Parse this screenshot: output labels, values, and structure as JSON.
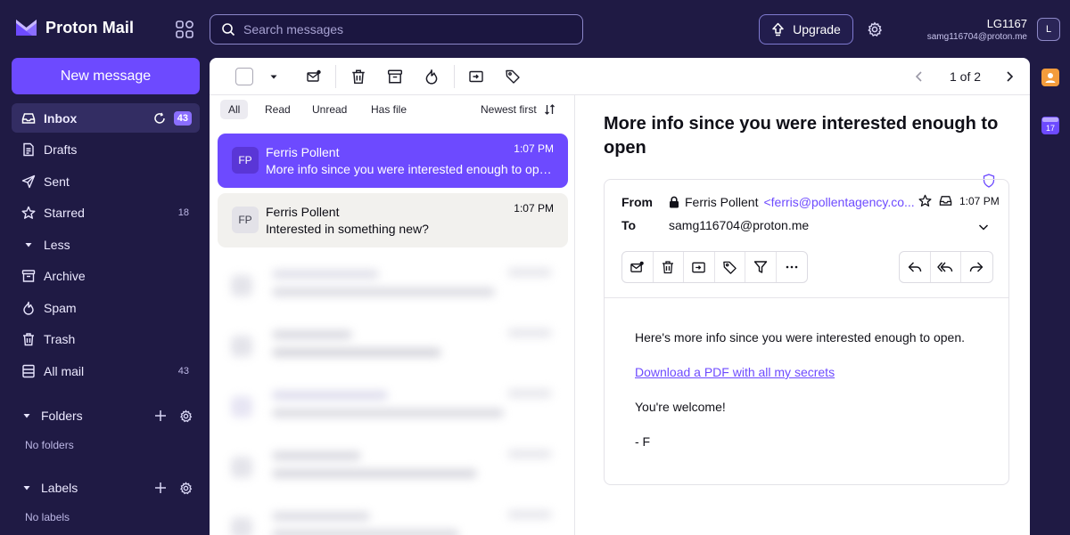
{
  "brand": {
    "name": "Proton Mail",
    "accent": "#6d4aff",
    "background": "#1f1a44"
  },
  "search": {
    "placeholder": "Search messages"
  },
  "header": {
    "upgrade_label": "Upgrade",
    "user_name": "LG1167",
    "user_email": "samg116704@proton.me",
    "avatar_initial": "L"
  },
  "sidebar": {
    "new_message": "New message",
    "items": [
      {
        "label": "Inbox",
        "icon": "inbox-icon",
        "badge": "43",
        "active": true
      },
      {
        "label": "Drafts",
        "icon": "drafts-icon",
        "count": ""
      },
      {
        "label": "Sent",
        "icon": "sent-icon",
        "count": ""
      },
      {
        "label": "Starred",
        "icon": "star-icon",
        "count": "18"
      },
      {
        "label": "Less",
        "icon": "caret-icon",
        "count": ""
      },
      {
        "label": "Archive",
        "icon": "archive-icon",
        "count": ""
      },
      {
        "label": "Spam",
        "icon": "spam-icon",
        "count": ""
      },
      {
        "label": "Trash",
        "icon": "trash-icon",
        "count": ""
      },
      {
        "label": "All mail",
        "icon": "all-mail-icon",
        "count": "43"
      }
    ],
    "folders": {
      "label": "Folders",
      "empty": "No folders"
    },
    "labels": {
      "label": "Labels",
      "empty": "No labels"
    }
  },
  "toolbar": {
    "pager": "1 of 2"
  },
  "list": {
    "filters": [
      "All",
      "Read",
      "Unread",
      "Has file"
    ],
    "active_filter": "All",
    "sort": "Newest first",
    "messages": [
      {
        "initials": "FP",
        "sender": "Ferris Pollent",
        "subject": "More info since you were interested enough to open",
        "time": "1:07 PM",
        "selected": true
      },
      {
        "initials": "FP",
        "sender": "Ferris Pollent",
        "subject": "Interested in something new?",
        "time": "1:07 PM",
        "selected": false
      }
    ]
  },
  "reader": {
    "subject": "More info since you were interested enough to open",
    "from_label": "From",
    "to_label": "To",
    "from_name": "Ferris Pollent",
    "from_address": "<ferris@pollentagency.co...",
    "to_address": "samg116704@proton.me",
    "time": "1:07 PM",
    "body": {
      "line1": "Here's more info since you were interested enough to open.",
      "link": "Download a PDF with all my secrets",
      "line2": "You're welcome!",
      "signoff": "- F"
    }
  },
  "app_strip": {
    "calendar_day": "17"
  }
}
